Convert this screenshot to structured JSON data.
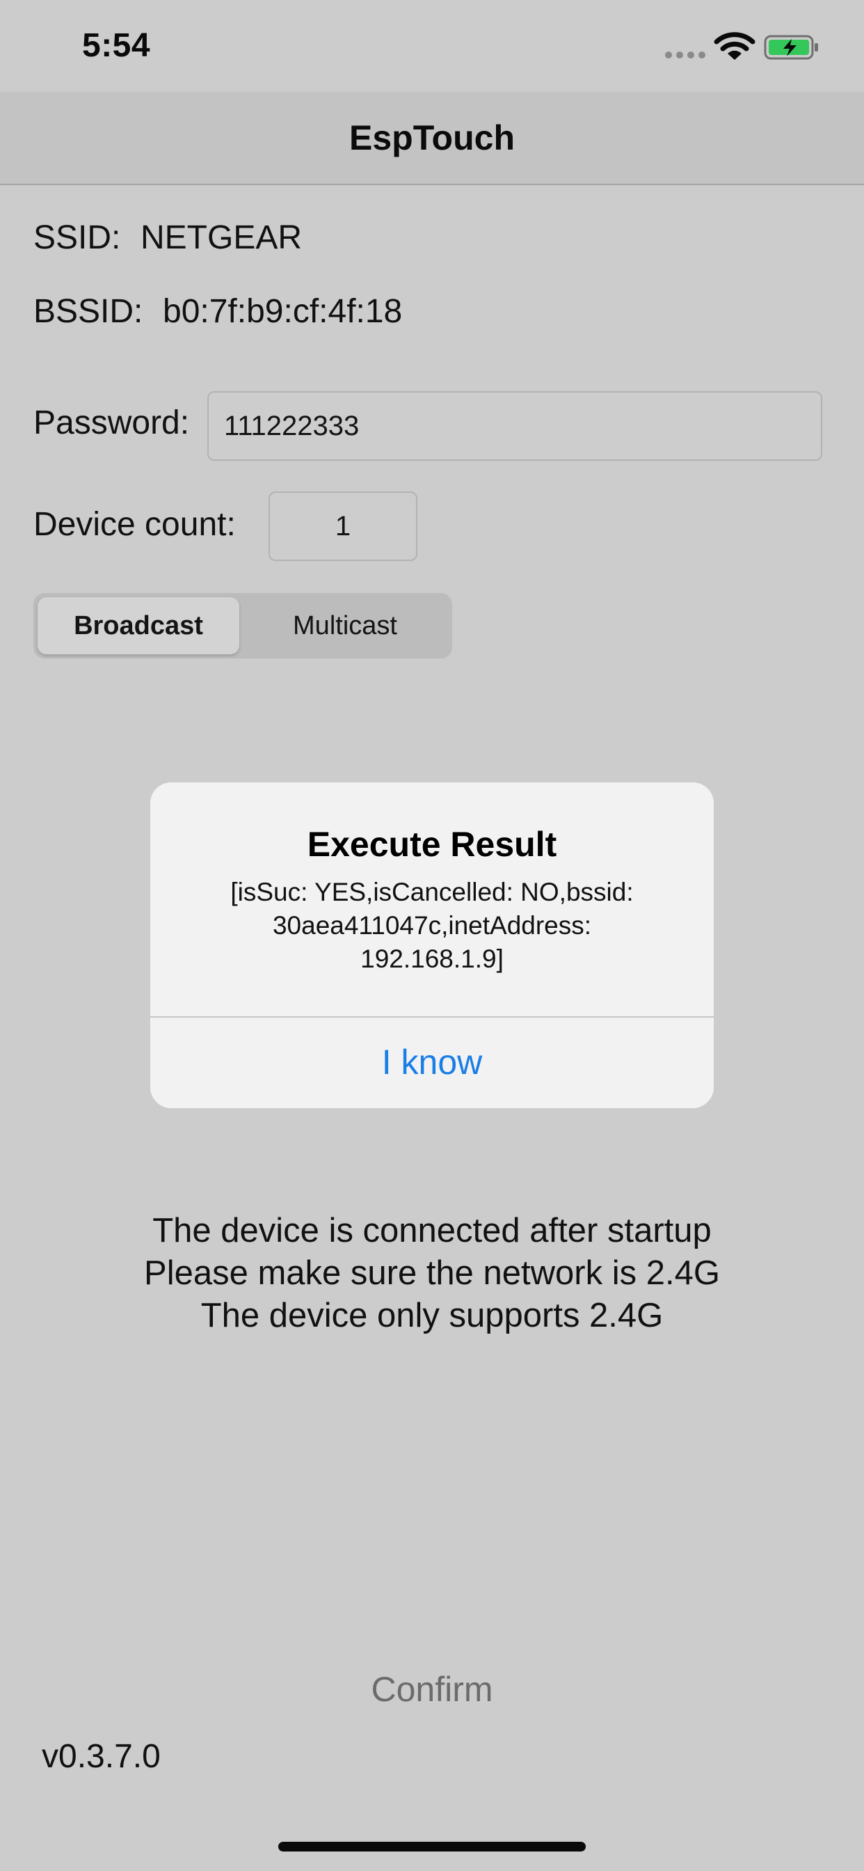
{
  "status_bar": {
    "time": "5:54",
    "signal_icon": "cellular-dots-icon",
    "wifi_icon": "wifi-icon",
    "battery_icon": "battery-charging-icon",
    "battery_color": "#34c759"
  },
  "nav": {
    "title": "EspTouch"
  },
  "form": {
    "ssid_label": "SSID:",
    "ssid_value": "NETGEAR",
    "bssid_label": "BSSID:",
    "bssid_value": "b0:7f:b9:cf:4f:18",
    "password_label": "Password:",
    "password_value": "111222333",
    "device_count_label": "Device count:",
    "device_count_value": "1"
  },
  "mode_segment": {
    "selected": "Broadcast",
    "options": [
      "Broadcast",
      "Multicast"
    ]
  },
  "alert": {
    "title": "Execute Result",
    "message_lines": [
      "[isSuc: YES,isCancelled: NO,bssid:",
      "30aea411047c,inetAddress:",
      "192.168.1.9]"
    ],
    "button_label": "I know",
    "button_color": "#1a7ee6"
  },
  "notice_lines": [
    "The device is connected after startup",
    "Please make sure the network is 2.4G",
    "The device only supports 2.4G"
  ],
  "confirm_label": "Confirm",
  "version": "v0.3.7.0"
}
